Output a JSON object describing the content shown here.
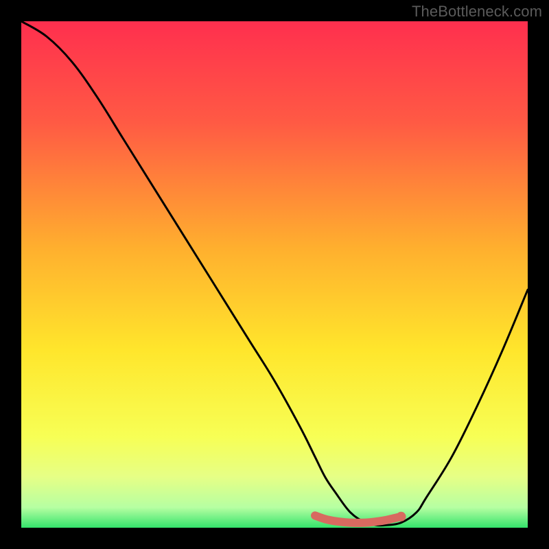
{
  "watermark": "TheBottleneck.com",
  "chart_data": {
    "type": "line",
    "title": "",
    "xlabel": "",
    "ylabel": "",
    "xlim": [
      0,
      100
    ],
    "ylim": [
      0,
      100
    ],
    "grid": false,
    "series": [
      {
        "name": "curve",
        "x": [
          0,
          5,
          10,
          15,
          20,
          25,
          30,
          35,
          40,
          45,
          50,
          55,
          58,
          60,
          62,
          65,
          68,
          70,
          72,
          75,
          78,
          80,
          85,
          90,
          95,
          100
        ],
        "y": [
          100,
          97,
          92,
          85,
          77,
          69,
          61,
          53,
          45,
          37,
          29,
          20,
          14,
          10,
          7,
          3,
          1,
          0.5,
          0.5,
          1,
          3,
          6,
          14,
          24,
          35,
          47
        ]
      }
    ],
    "highlight_segment": {
      "name": "optimal-range",
      "x": [
        58,
        60,
        62,
        65,
        68,
        70,
        72,
        75
      ],
      "y": [
        2.4,
        1.7,
        1.3,
        1.0,
        1.0,
        1.2,
        1.5,
        2.2
      ],
      "color": "#d86a60"
    },
    "gradient_stops": [
      {
        "pos": 0.0,
        "color": "#ff2f4e"
      },
      {
        "pos": 0.2,
        "color": "#ff5a44"
      },
      {
        "pos": 0.45,
        "color": "#ffb02e"
      },
      {
        "pos": 0.65,
        "color": "#ffe62c"
      },
      {
        "pos": 0.82,
        "color": "#f7ff55"
      },
      {
        "pos": 0.9,
        "color": "#e6ff86"
      },
      {
        "pos": 0.96,
        "color": "#b6ffa2"
      },
      {
        "pos": 1.0,
        "color": "#34e36b"
      }
    ]
  }
}
